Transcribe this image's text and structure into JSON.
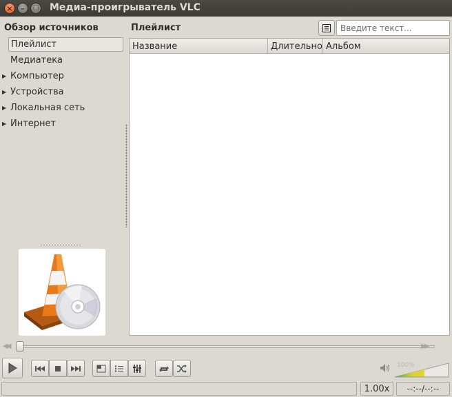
{
  "window": {
    "title": "Медиа-проигрыватель VLC",
    "close_glyph": "×",
    "minimize_glyph": "–",
    "maximize_glyph": "□"
  },
  "sidebar": {
    "title": "Обзор источников",
    "items": [
      {
        "label": "Плейлист",
        "selected": true,
        "expandable": false
      },
      {
        "label": "Медиатека",
        "selected": false,
        "expandable": false
      },
      {
        "label": "Компьютер",
        "selected": false,
        "expandable": true
      },
      {
        "label": "Устройства",
        "selected": false,
        "expandable": true
      },
      {
        "label": "Локальная сеть",
        "selected": false,
        "expandable": true
      },
      {
        "label": "Интернет",
        "selected": false,
        "expandable": true
      }
    ],
    "expand_arrow": "▶",
    "art_icon": "vlc-cone-with-disc-icon"
  },
  "playlist": {
    "title": "Плейлист",
    "view_button_icon": "list-view-icon",
    "search_placeholder": "Введите текст...",
    "columns": [
      "Название",
      "Длительность",
      "Альбом"
    ],
    "rows": []
  },
  "controls": {
    "icons": [
      "play-icon",
      "previous-icon",
      "stop-icon",
      "next-icon",
      "fullscreen-icon",
      "playlist-icon",
      "extended-settings-icon",
      "loop-icon",
      "shuffle-icon"
    ],
    "seek_position": 0,
    "volume_label": "100%",
    "volume_level": 1.0
  },
  "status": {
    "speed": "1.00x",
    "time": "--:--/--:--"
  },
  "colors": {
    "title_bar": "#3c3b37",
    "close_button": "#e45a1f",
    "window_bg": "#dcd9d3",
    "cone_orange": "#e8781a"
  }
}
